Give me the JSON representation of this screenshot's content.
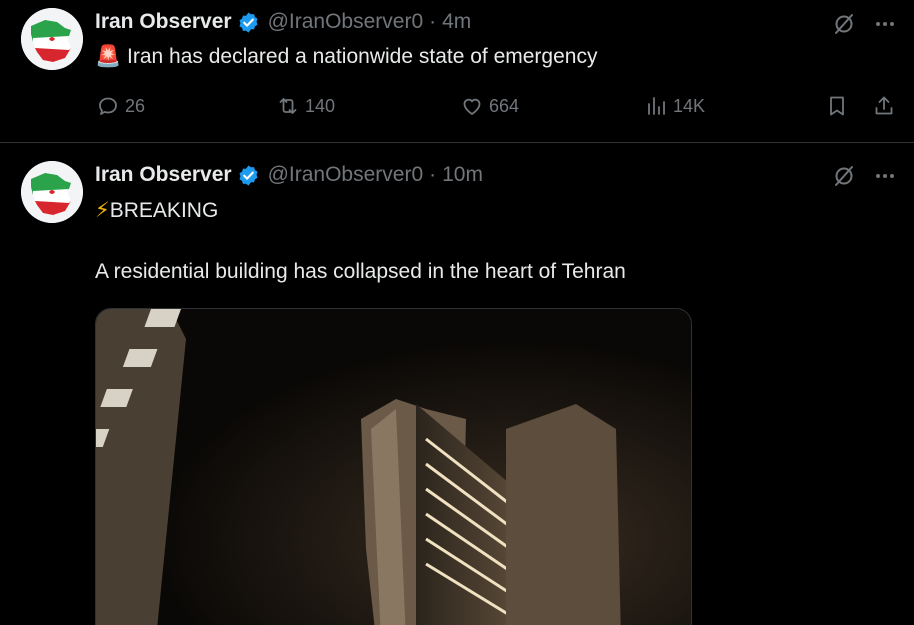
{
  "tweets": [
    {
      "author": "Iran Observer",
      "handle": "@IranObserver0",
      "separator": "·",
      "time": "4m",
      "text": "Iran has declared a nationwide state of emergency",
      "emoji": "🚨",
      "actions": {
        "replies": "26",
        "reposts": "140",
        "likes": "664",
        "views": "14K"
      }
    },
    {
      "author": "Iran Observer",
      "handle": "@IranObserver0",
      "separator": "·",
      "time": "10m",
      "line1_emoji": "⚡",
      "line1": "BREAKING",
      "line2": "A residential building has collapsed in the heart of Tehran"
    }
  ],
  "colors": {
    "background": "#000000",
    "text": "#e7e9ea",
    "muted": "#71767b",
    "verified": "#1d9bf0",
    "divider": "#2f3336"
  }
}
